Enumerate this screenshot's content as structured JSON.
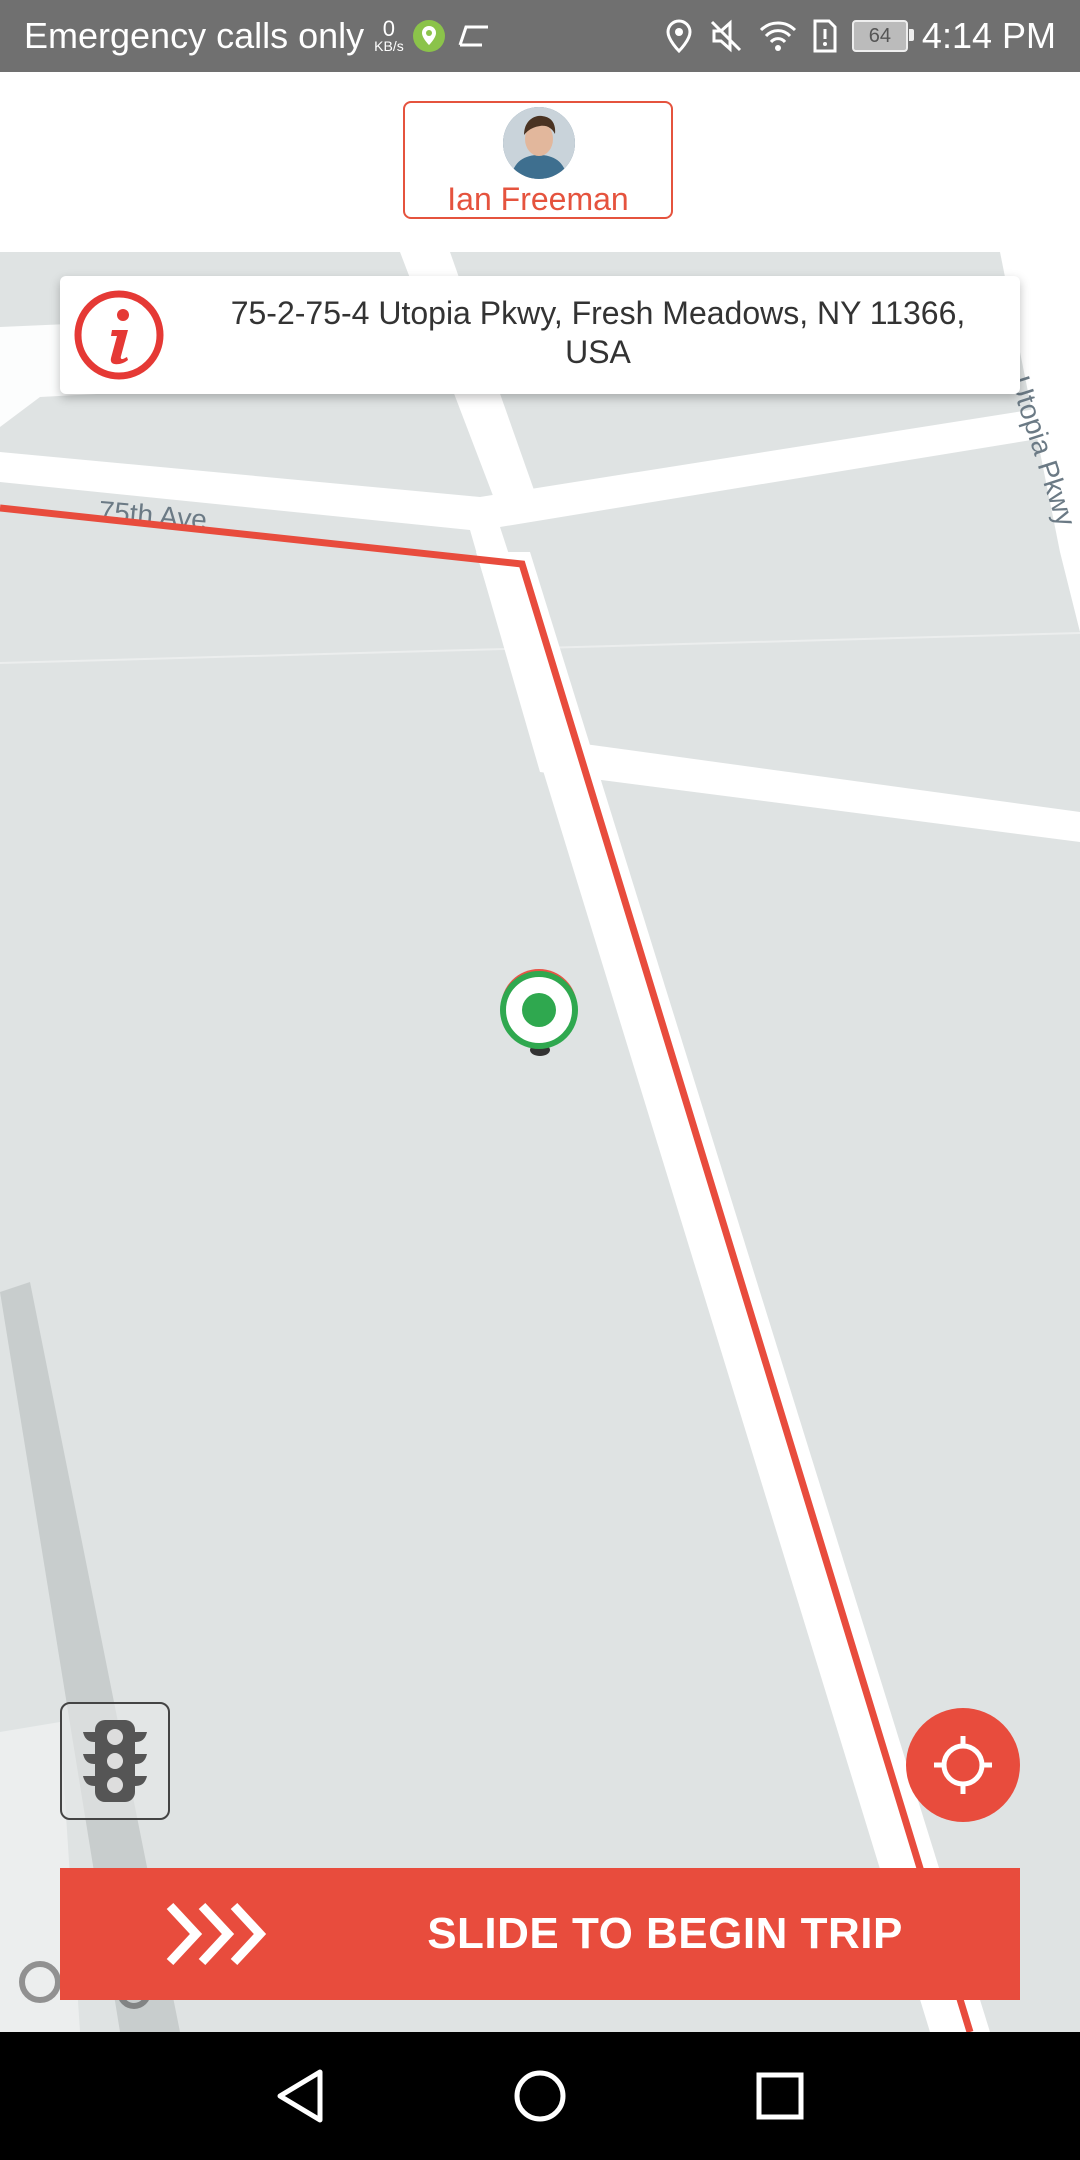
{
  "status_bar": {
    "carrier": "Emergency calls only",
    "net_speed_value": "0",
    "net_speed_unit": "KB/s",
    "battery": "64",
    "time": "4:14 PM"
  },
  "driver": {
    "name": "Ian Freeman"
  },
  "address": {
    "text": "75-2-75-4 Utopia Pkwy, Fresh Meadows, NY 11366, USA"
  },
  "map": {
    "street_labels": [
      "75th Ave",
      "Utopia Pkwy"
    ],
    "route_color": "#e84c3d",
    "marker_color": "#2fa84f"
  },
  "actions": {
    "slide_label": "SLIDE TO BEGIN TRIP"
  },
  "colors": {
    "accent": "#e84c3d",
    "map_background": "#dfe3e3"
  },
  "icons": [
    "info-icon",
    "traffic-light-icon",
    "my-location-icon",
    "chevrons-right-icon",
    "back-icon",
    "home-icon",
    "recents-icon"
  ]
}
